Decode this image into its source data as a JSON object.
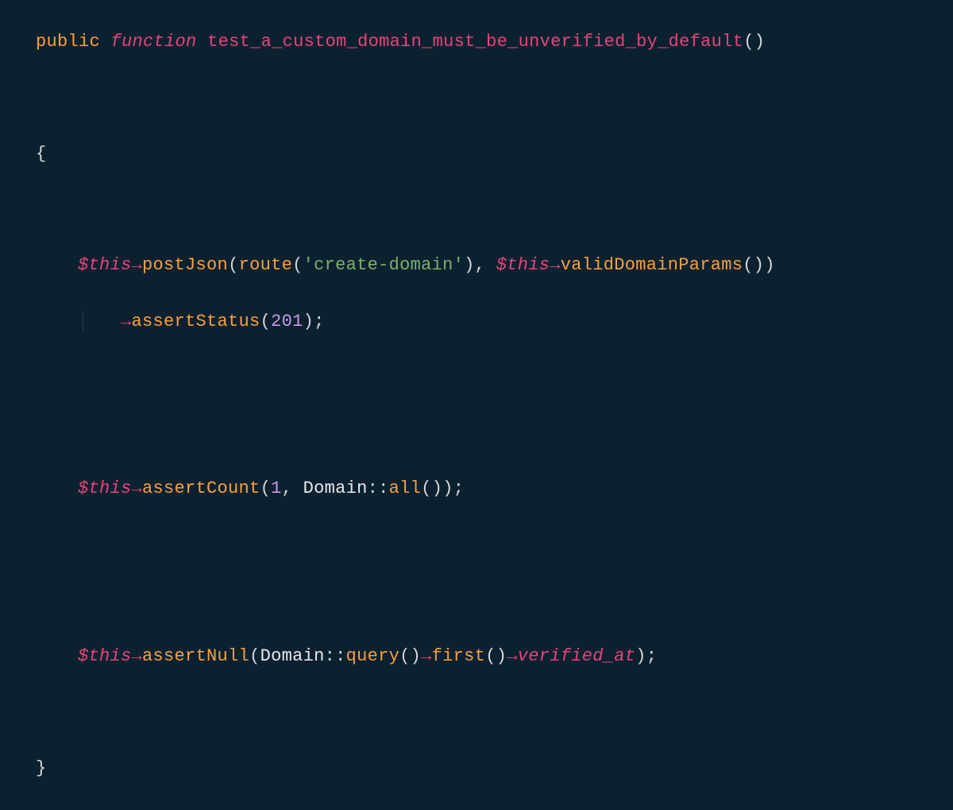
{
  "code": {
    "kw_public": "public",
    "kw_function": "function",
    "fn_name": "test_a_custom_domain_must_be_unverified_by_default",
    "open_brace": "{",
    "close_brace": "}",
    "this": "$this",
    "arrow": "→",
    "paren_open": "(",
    "paren_close": ")",
    "semi": ";",
    "comma": ",",
    "dcolon": "::",
    "postJson": "postJson",
    "route": "route",
    "str_create_domain": "'create-domain'",
    "validDomainParams": "validDomainParams",
    "assertStatus": "assertStatus",
    "num_201": "201",
    "assertCount": "assertCount",
    "num_1": "1",
    "Domain": "Domain",
    "all": "all",
    "assertNull": "assertNull",
    "query": "query",
    "first": "first",
    "verified_at": "verified_at"
  }
}
